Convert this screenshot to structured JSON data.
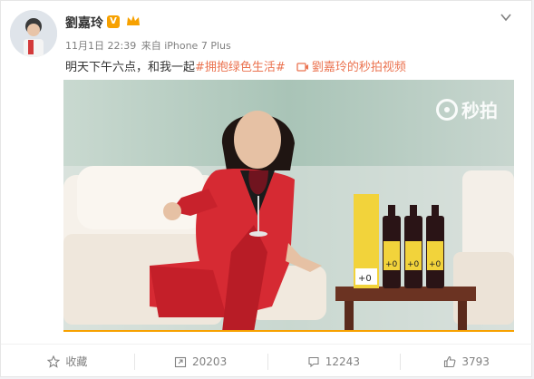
{
  "post": {
    "author": "劉嘉玲",
    "verified_badge": "V",
    "member_icon": "crown-icon",
    "timestamp": "11月1日 22:39",
    "source": "来自 iPhone 7 Plus",
    "text_prefix": "明天下午六点，和我一起",
    "hashtag": "#拥抱绿色生活#",
    "video_link": "劉嘉玲的秒拍视频",
    "watermark": "秒拍",
    "video_progress": 1.0
  },
  "actions": [
    {
      "icon": "star-icon",
      "label": "收藏"
    },
    {
      "icon": "repost-icon",
      "label": "20203"
    },
    {
      "icon": "comment-icon",
      "label": "12243"
    },
    {
      "icon": "like-icon",
      "label": "3793"
    }
  ],
  "colors": {
    "accent": "#eb7350",
    "badge": "#f7a100",
    "suit": "#d62a33",
    "wine_label": "#f2d33b"
  }
}
